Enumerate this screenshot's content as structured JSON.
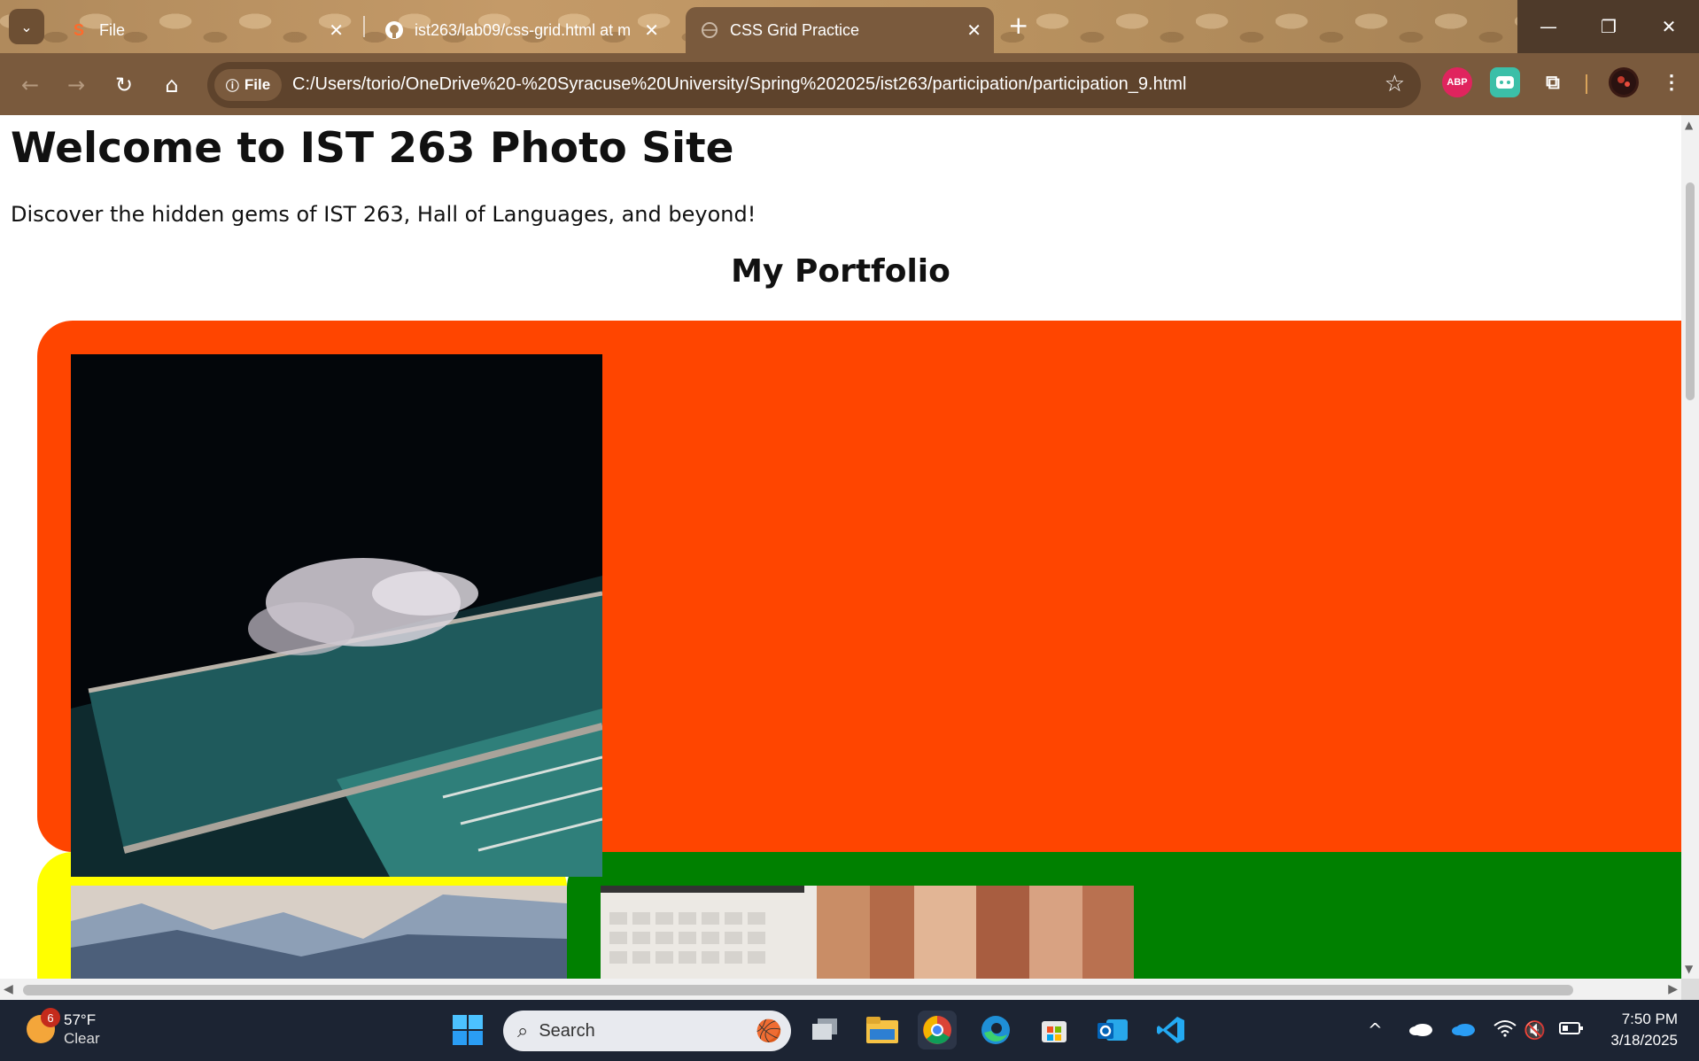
{
  "browser": {
    "tabs": [
      {
        "label": "File",
        "icon": "S",
        "active": false
      },
      {
        "label": "ist263/lab09/css-grid.html at m",
        "icon": "github-icon",
        "active": false
      },
      {
        "label": "CSS Grid Practice",
        "icon": "globe-icon",
        "active": true
      }
    ],
    "new_tab": "+",
    "window": {
      "minimize": "—",
      "restore": "❐",
      "close": "✕"
    },
    "nav": {
      "back": "←",
      "forward": "→",
      "reload": "↻",
      "home": "⌂"
    },
    "security_chip": "File",
    "url": "C:/Users/torio/OneDrive%20-%20Syracuse%20University/Spring%202025/ist263/participation/participation_9.html",
    "bookmark_icon": "☆",
    "extensions": {
      "abp": "ABP",
      "puzzle": "⧉",
      "menu": "⋮"
    }
  },
  "page": {
    "title": "Welcome to IST 263 Photo Site",
    "tagline": "Discover the hidden gems of IST 263, Hall of Languages, and beyond!",
    "portfolio_heading": "My Portfolio",
    "card_colors": {
      "red": "#ff4500",
      "yellow": "#ffff00",
      "green": "#008000"
    }
  },
  "taskbar": {
    "weather": {
      "badge": "6",
      "temp": "57°F",
      "condition": "Clear"
    },
    "search_placeholder": "Search",
    "clock": {
      "time": "7:50 PM",
      "date": "3/18/2025"
    },
    "tray": {
      "chevron": "^",
      "volume": "🔇"
    }
  }
}
